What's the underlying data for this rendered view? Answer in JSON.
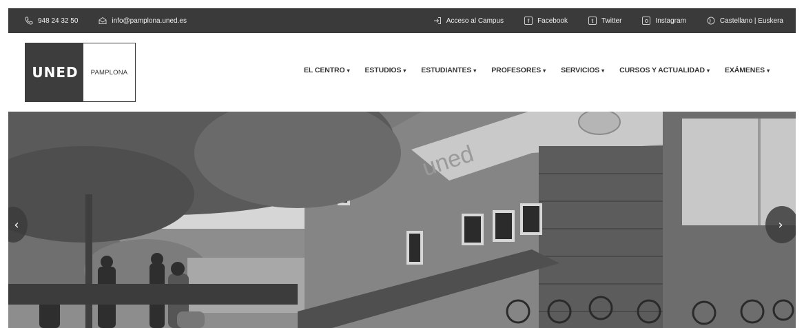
{
  "topbar": {
    "phone": "948 24 32 50",
    "email": "info@pamplona.uned.es",
    "campus": "Acceso al Campus",
    "facebook": "Facebook",
    "twitter": "Twitter",
    "instagram": "Instagram",
    "language": "Castellano | Euskera"
  },
  "logo": {
    "uned": "UNED",
    "pamplona": "PAMPLONA"
  },
  "nav": {
    "items": [
      "EL CENTRO",
      "ESTUDIOS",
      "ESTUDIANTES",
      "PROFESORES",
      "SERVICIOS",
      "CURSOS Y ACTUALIDAD",
      "EXÁMENES"
    ]
  },
  "hero": {
    "sign_text": "uned",
    "prev_label": "‹",
    "next_label": "›"
  },
  "colors": {
    "topbar_bg": "#3a3a3a",
    "logo_bg": "#3d3d3d",
    "nav_text": "#333333"
  }
}
